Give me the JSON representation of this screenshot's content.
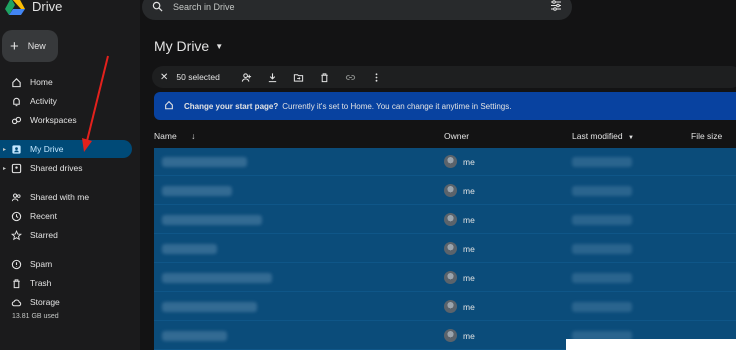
{
  "app": {
    "name": "Drive"
  },
  "sidebar": {
    "new_label": "New",
    "items": [
      {
        "label": "Home",
        "icon": "home-icon"
      },
      {
        "label": "Activity",
        "icon": "bell-icon"
      },
      {
        "label": "Workspaces",
        "icon": "workspaces-icon"
      },
      {
        "label": "My Drive",
        "icon": "my-drive-icon",
        "active": true
      },
      {
        "label": "Shared drives",
        "icon": "shared-drives-icon"
      },
      {
        "label": "Shared with me",
        "icon": "people-icon"
      },
      {
        "label": "Recent",
        "icon": "clock-icon"
      },
      {
        "label": "Starred",
        "icon": "star-icon"
      },
      {
        "label": "Spam",
        "icon": "spam-icon"
      },
      {
        "label": "Trash",
        "icon": "trash-icon"
      },
      {
        "label": "Storage",
        "icon": "cloud-icon"
      }
    ],
    "storage_used": "13.81 GB used"
  },
  "search": {
    "placeholder": "Search in Drive"
  },
  "page": {
    "title": "My Drive"
  },
  "selection": {
    "count_label": "50 selected"
  },
  "banner": {
    "bold": "Change your start page?",
    "text": "Currently it's set to Home. You can change it anytime in Settings."
  },
  "columns": {
    "name": "Name",
    "owner": "Owner",
    "last_modified": "Last modified",
    "file_size": "File size"
  },
  "rows": [
    {
      "owner": "me"
    },
    {
      "owner": "me"
    },
    {
      "owner": "me"
    },
    {
      "owner": "me"
    },
    {
      "owner": "me"
    },
    {
      "owner": "me"
    },
    {
      "owner": "me"
    }
  ],
  "colors": {
    "selected_row": "#0b4c7a",
    "banner": "#0842a0",
    "active_nav": "#004a77",
    "annotation_arrow": "#e3211c"
  }
}
